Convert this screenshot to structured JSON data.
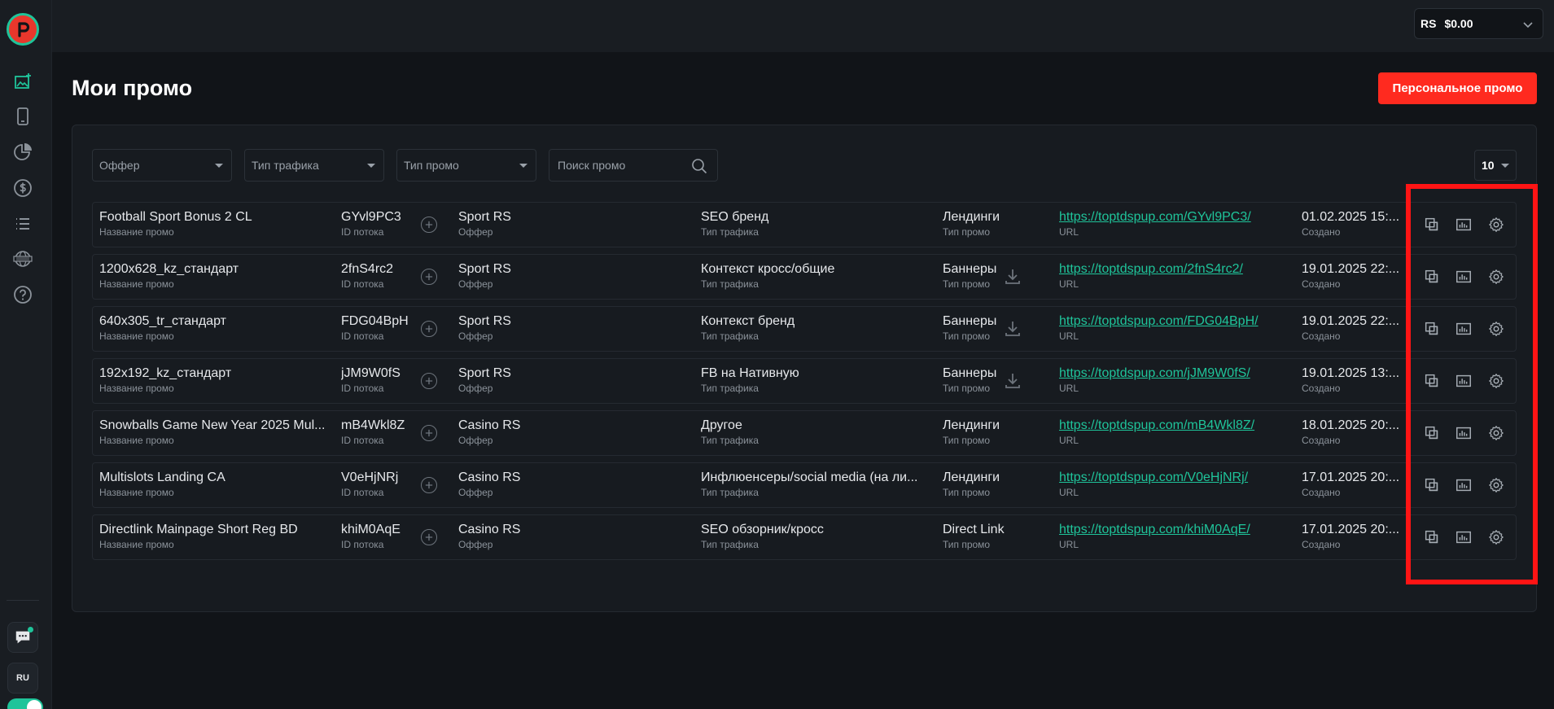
{
  "sidebar": {
    "language": "RU"
  },
  "topbar": {
    "currency": "RS",
    "balance": "$0.00"
  },
  "page": {
    "title": "Мои промо",
    "personal_promo_button": "Персональное промо"
  },
  "filters": {
    "offer": "Оффер",
    "traffic_type": "Тип трафика",
    "promo_type": "Тип промо",
    "search_placeholder": "Поиск промо",
    "per_page": "10"
  },
  "labels": {
    "name": "Название промо",
    "id": "ID потока",
    "offer": "Оффер",
    "traffic": "Тип трафика",
    "type": "Тип промо",
    "url": "URL",
    "created": "Создано"
  },
  "rows": [
    {
      "name": "Football Sport Bonus 2 CL",
      "id": "GYvl9PC3",
      "offer": "Sport RS",
      "traffic": "SEO бренд",
      "type": "Лендинги",
      "url": "https://toptdspup.com/GYvl9PC3/",
      "created": "01.02.2025 15:...",
      "download": false
    },
    {
      "name": "1200x628_kz_стандарт",
      "id": "2fnS4rc2",
      "offer": "Sport RS",
      "traffic": "Контекст кросс/общие",
      "type": "Баннеры",
      "url": "https://toptdspup.com/2fnS4rc2/",
      "created": "19.01.2025 22:...",
      "download": true
    },
    {
      "name": "640x305_tr_стандарт",
      "id": "FDG04BpH",
      "offer": "Sport RS",
      "traffic": "Контекст бренд",
      "type": "Баннеры",
      "url": "https://toptdspup.com/FDG04BpH/",
      "created": "19.01.2025 22:...",
      "download": true
    },
    {
      "name": "192x192_kz_стандарт",
      "id": "jJM9W0fS",
      "offer": "Sport RS",
      "traffic": "FB на Нативную",
      "type": "Баннеры",
      "url": "https://toptdspup.com/jJM9W0fS/",
      "created": "19.01.2025 13:...",
      "download": true
    },
    {
      "name": "Snowballs Game New Year 2025 Mul...",
      "id": "mB4Wkl8Z",
      "offer": "Casino RS",
      "traffic": "Другое",
      "type": "Лендинги",
      "url": "https://toptdspup.com/mB4Wkl8Z/",
      "created": "18.01.2025 20:...",
      "download": false
    },
    {
      "name": "Multislots Landing CA",
      "id": "V0eHjNRj",
      "offer": "Casino RS",
      "traffic": "Инфлюенсеры/social media (на ли...",
      "type": "Лендинги",
      "url": "https://toptdspup.com/V0eHjNRj/",
      "created": "17.01.2025 20:...",
      "download": false
    },
    {
      "name": "Directlink Mainpage Short Reg BD",
      "id": "khiM0AqE",
      "offer": "Casino RS",
      "traffic": "SEO обзорник/кросс",
      "type": "Direct Link",
      "url": "https://toptdspup.com/khiM0AqE/",
      "created": "17.01.2025 20:...",
      "download": false
    }
  ],
  "colors": {
    "accent": "#1fc49a",
    "primary_button": "#ff2a1f",
    "highlight": "#ff1414",
    "background": "#111418"
  }
}
